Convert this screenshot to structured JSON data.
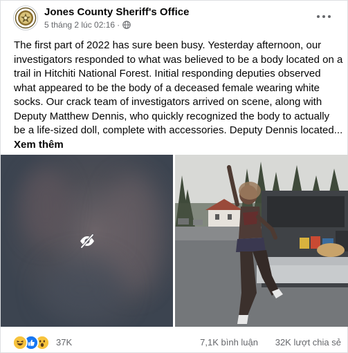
{
  "post": {
    "page_name": "Jones County Sheriff's Office",
    "timestamp": "5 tháng 2 lúc 02:16",
    "visibility_icon": "globe-icon",
    "text": "The first part of 2022 has sure been busy. Yesterday afternoon, our investigators responded to what was believed to be a body located on a trail in Hitchiti National Forest. Initial responding deputies observed what appeared to be the body of a deceased female wearing white socks. Our crack team of investigators arrived on scene, along with Deputy Matthew Dennis, who quickly recognized the body to actually be a life-sized doll, complete with accessories. Deputy Dennis located... ",
    "see_more": "Xem thêm"
  },
  "media": {
    "left_photo_state": "hidden",
    "left_photo_icon": "eye-slash-icon",
    "right_photo_icon": "photo"
  },
  "stats": {
    "reactions": [
      "haha",
      "like",
      "wow"
    ],
    "reaction_count": "37K",
    "comments": "7,1K bình luận",
    "shares": "32K lượt chia sẻ"
  },
  "colors": {
    "secondary_text": "#65676b",
    "like_blue": "#1877f2",
    "emoji_yellow": "#f7c33d"
  }
}
